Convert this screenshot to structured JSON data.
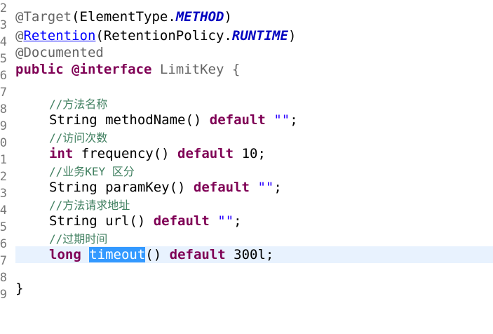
{
  "gutter": {
    "line_numbers": [
      "2",
      "3",
      "4",
      "5",
      "6",
      "7",
      "8",
      "9",
      "0",
      "1",
      "2",
      "3",
      "4",
      "5",
      "6",
      "7",
      "8",
      "9"
    ]
  },
  "code": {
    "l2": {
      "at": "@",
      "anno": "Target",
      "p1": "(ElementType.",
      "const": "METHOD",
      "p2": ")"
    },
    "l3": {
      "at": "@",
      "anno": "Retention",
      "p1": "(RetentionPolicy.",
      "const": "RUNTIME",
      "p2": ")"
    },
    "l4": {
      "anno": "@Documented"
    },
    "l5": {
      "kw1": "public",
      "kw2": "@interface",
      "name": " LimitKey {"
    },
    "l7": {
      "comment": "//方法名称"
    },
    "l8": {
      "type": "String methodName() ",
      "kw": "default",
      "str": "\"\"",
      "end": ";"
    },
    "l9": {
      "comment": "//访问次数"
    },
    "l10": {
      "kw1": "int",
      "text": " frequency() ",
      "kw2": "default",
      "end": " 10;"
    },
    "l11": {
      "comment": "//业务KEY 区分"
    },
    "l12": {
      "type": "String paramKey() ",
      "kw": "default",
      "str": "\"\"",
      "end": ";"
    },
    "l13": {
      "comment": "//方法请求地址"
    },
    "l14": {
      "type": "String url() ",
      "kw": "default",
      "str": "\"\"",
      "end": ";"
    },
    "l15": {
      "comment": "//过期时间"
    },
    "l16": {
      "kw1": "long",
      "selected": "timeout",
      "text": "() ",
      "kw2": "default",
      "end": " 300l;"
    },
    "l18": {
      "text": "}"
    }
  },
  "colors": {
    "keyword": "#7f0055",
    "annotation": "#646464",
    "comment": "#3f7f5f",
    "string": "#2a00ff",
    "constant": "#0000c0",
    "selection": "#3399ff",
    "current_line": "#e8f2fe"
  }
}
